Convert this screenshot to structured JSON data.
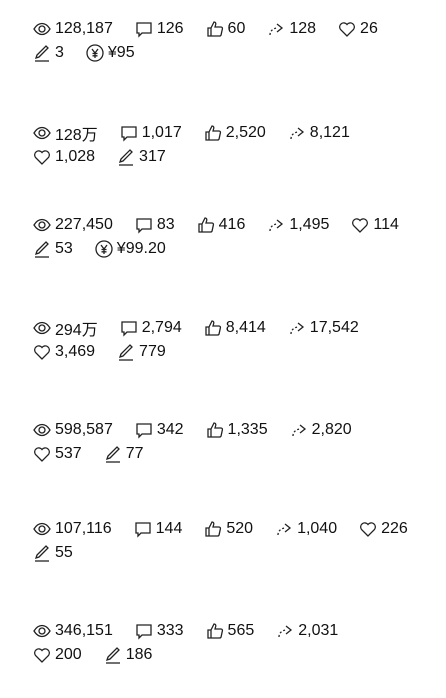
{
  "posts": [
    {
      "rows": [
        [
          {
            "icon": "eye",
            "value": "128,187"
          },
          {
            "icon": "comment",
            "value": "126"
          },
          {
            "icon": "like",
            "value": "60"
          },
          {
            "icon": "share",
            "value": "128"
          },
          {
            "icon": "heart",
            "value": "26"
          }
        ],
        [
          {
            "icon": "pencil",
            "value": "3"
          },
          {
            "icon": "yuan",
            "value": "¥95"
          }
        ]
      ]
    },
    {
      "rows": [
        [
          {
            "icon": "eye",
            "value": "128万"
          },
          {
            "icon": "comment",
            "value": "1,017"
          },
          {
            "icon": "like",
            "value": "2,520"
          },
          {
            "icon": "share",
            "value": "8,121"
          }
        ],
        [
          {
            "icon": "heart",
            "value": "1,028"
          },
          {
            "icon": "pencil",
            "value": "317"
          }
        ]
      ]
    },
    {
      "rows": [
        [
          {
            "icon": "eye",
            "value": "227,450"
          },
          {
            "icon": "comment",
            "value": "83"
          },
          {
            "icon": "like",
            "value": "416"
          },
          {
            "icon": "share",
            "value": "1,495"
          },
          {
            "icon": "heart",
            "value": "114"
          }
        ],
        [
          {
            "icon": "pencil",
            "value": "53"
          },
          {
            "icon": "yuan",
            "value": "¥99.20"
          }
        ]
      ]
    },
    {
      "rows": [
        [
          {
            "icon": "eye",
            "value": "294万"
          },
          {
            "icon": "comment",
            "value": "2,794"
          },
          {
            "icon": "like",
            "value": "8,414"
          },
          {
            "icon": "share",
            "value": "17,542"
          }
        ],
        [
          {
            "icon": "heart",
            "value": "3,469"
          },
          {
            "icon": "pencil",
            "value": "779"
          }
        ]
      ]
    },
    {
      "rows": [
        [
          {
            "icon": "eye",
            "value": "598,587"
          },
          {
            "icon": "comment",
            "value": "342"
          },
          {
            "icon": "like",
            "value": "1,335"
          },
          {
            "icon": "share",
            "value": "2,820"
          }
        ],
        [
          {
            "icon": "heart",
            "value": "537"
          },
          {
            "icon": "pencil",
            "value": "77"
          }
        ]
      ]
    },
    {
      "rows": [
        [
          {
            "icon": "eye",
            "value": "107,116"
          },
          {
            "icon": "comment",
            "value": "144"
          },
          {
            "icon": "like",
            "value": "520"
          },
          {
            "icon": "share",
            "value": "1,040"
          },
          {
            "icon": "heart",
            "value": "226"
          }
        ],
        [
          {
            "icon": "pencil",
            "value": "55"
          }
        ]
      ]
    },
    {
      "rows": [
        [
          {
            "icon": "eye",
            "value": "346,151"
          },
          {
            "icon": "comment",
            "value": "333"
          },
          {
            "icon": "like",
            "value": "565"
          },
          {
            "icon": "share",
            "value": "2,031"
          }
        ],
        [
          {
            "icon": "heart",
            "value": "200"
          },
          {
            "icon": "pencil",
            "value": "186"
          }
        ]
      ]
    }
  ]
}
